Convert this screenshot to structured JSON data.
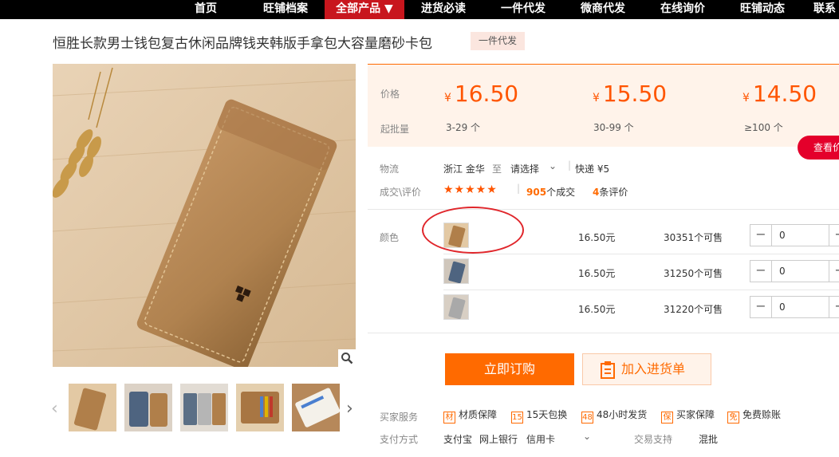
{
  "nav": [
    "首页",
    "旺铺档案",
    "全部产品 ▼",
    "进货必读",
    "一件代发",
    "微商代发",
    "在线询价",
    "旺铺动态",
    "联系"
  ],
  "title": "恒胜长款男士钱包复古休闲品牌钱夹韩版手拿包大容量磨砂卡包",
  "tag": "一件代发",
  "price_label": "价格",
  "moq_label": "起批量",
  "currency": "¥",
  "tiers": [
    {
      "price": "16.50",
      "qty": "3-29 个"
    },
    {
      "price": "15.50",
      "qty": "30-99 个"
    },
    {
      "price": "14.50",
      "qty": "≥100 个"
    }
  ],
  "view_btn": "查看价",
  "logistics": {
    "label": "物流",
    "from": "浙江 金华",
    "to_word": "至",
    "select": "请选择",
    "express": "快递 ¥5"
  },
  "reviews": {
    "label": "成交\\评价",
    "stars": "★★★★★",
    "deals_num": "905",
    "deals_text": "个成交",
    "review_num": "4",
    "review_text": "条评价"
  },
  "color_label": "颜色",
  "variants": [
    {
      "price": "16.50元",
      "stock": "30351个可售",
      "qty": "0"
    },
    {
      "price": "16.50元",
      "stock": "31250个可售",
      "qty": "0"
    },
    {
      "price": "16.50元",
      "stock": "31220个可售",
      "qty": "0"
    }
  ],
  "order_btn": "立即订购",
  "cart_btn": "加入进货单",
  "services_label": "买家服务",
  "services": [
    {
      "icon": "材",
      "text": "材质保障"
    },
    {
      "icon": "15",
      "text": "15天包换"
    },
    {
      "icon": "48",
      "text": "48小时发货"
    },
    {
      "icon": "保",
      "text": "买家保障"
    },
    {
      "icon": "免",
      "text": "免费赊账"
    }
  ],
  "payment_label": "支付方式",
  "payments": [
    "支付宝",
    "网上银行",
    "信用卡"
  ],
  "trade_label": "交易支持",
  "trade_value": "混批",
  "colors": {
    "accent": "#ff6a00",
    "nav_active": "#c8161d",
    "price_bg": "#fff3ea"
  }
}
